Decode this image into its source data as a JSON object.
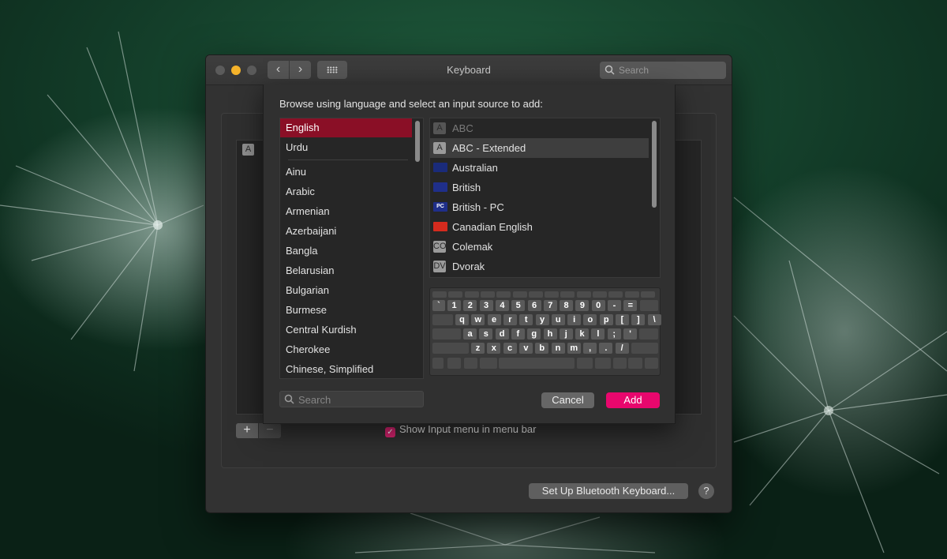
{
  "window": {
    "title": "Keyboard",
    "search_placeholder": "Search",
    "back_label": "‹",
    "forward_label": "›"
  },
  "main": {
    "list_first_badge": "A",
    "add_label": "+",
    "remove_label": "−",
    "show_input_menu": {
      "label": "Show Input menu in menu bar",
      "checked": true
    },
    "bluetooth_button": "Set Up Bluetooth Keyboard...",
    "help_label": "?"
  },
  "sheet": {
    "heading": "Browse using language and select an input source to add:",
    "languages": [
      {
        "label": "English",
        "selected": true
      },
      {
        "label": "Urdu"
      },
      {
        "label": "Ainu"
      },
      {
        "label": "Arabic"
      },
      {
        "label": "Armenian"
      },
      {
        "label": "Azerbaijani"
      },
      {
        "label": "Bangla"
      },
      {
        "label": "Belarusian"
      },
      {
        "label": "Bulgarian"
      },
      {
        "label": "Burmese"
      },
      {
        "label": "Central Kurdish"
      },
      {
        "label": "Cherokee"
      },
      {
        "label": "Chinese, Simplified"
      }
    ],
    "input_sources": [
      {
        "label": "ABC",
        "icon": "A",
        "icon_name": "abc-icon",
        "state": "dim"
      },
      {
        "label": "ABC - Extended",
        "icon": "A",
        "icon_name": "abc-extended-icon",
        "state": "highlight"
      },
      {
        "label": "Australian",
        "icon_name": "australia-flag-icon",
        "flag_color": "#1a2b7a"
      },
      {
        "label": "British",
        "icon_name": "uk-flag-icon",
        "flag_color": "#1f2f8a"
      },
      {
        "label": "British - PC",
        "icon_name": "uk-pc-flag-icon",
        "flag_color": "#1f2f8a",
        "flag_text": "PC"
      },
      {
        "label": "Canadian English",
        "icon_name": "canada-flag-icon",
        "flag_color": "#d52b1e"
      },
      {
        "label": "Colemak",
        "icon": "CO",
        "icon_name": "colemak-icon"
      },
      {
        "label": "Dvorak",
        "icon": "DV",
        "icon_name": "dvorak-icon"
      }
    ],
    "keyboard_rows": [
      [
        "`",
        "1",
        "2",
        "3",
        "4",
        "5",
        "6",
        "7",
        "8",
        "9",
        "0",
        "-",
        "="
      ],
      [
        "q",
        "w",
        "e",
        "r",
        "t",
        "y",
        "u",
        "i",
        "o",
        "p",
        "[",
        "]",
        "\\"
      ],
      [
        "a",
        "s",
        "d",
        "f",
        "g",
        "h",
        "j",
        "k",
        "l",
        ";",
        "'"
      ],
      [
        "z",
        "x",
        "c",
        "v",
        "b",
        "n",
        "m",
        ",",
        ".",
        "/"
      ]
    ],
    "search_placeholder": "Search",
    "cancel_label": "Cancel",
    "add_label": "Add"
  },
  "colors": {
    "accent": "#e8076d",
    "selection": "#8a0f26",
    "minimize": "#f5b32a"
  }
}
